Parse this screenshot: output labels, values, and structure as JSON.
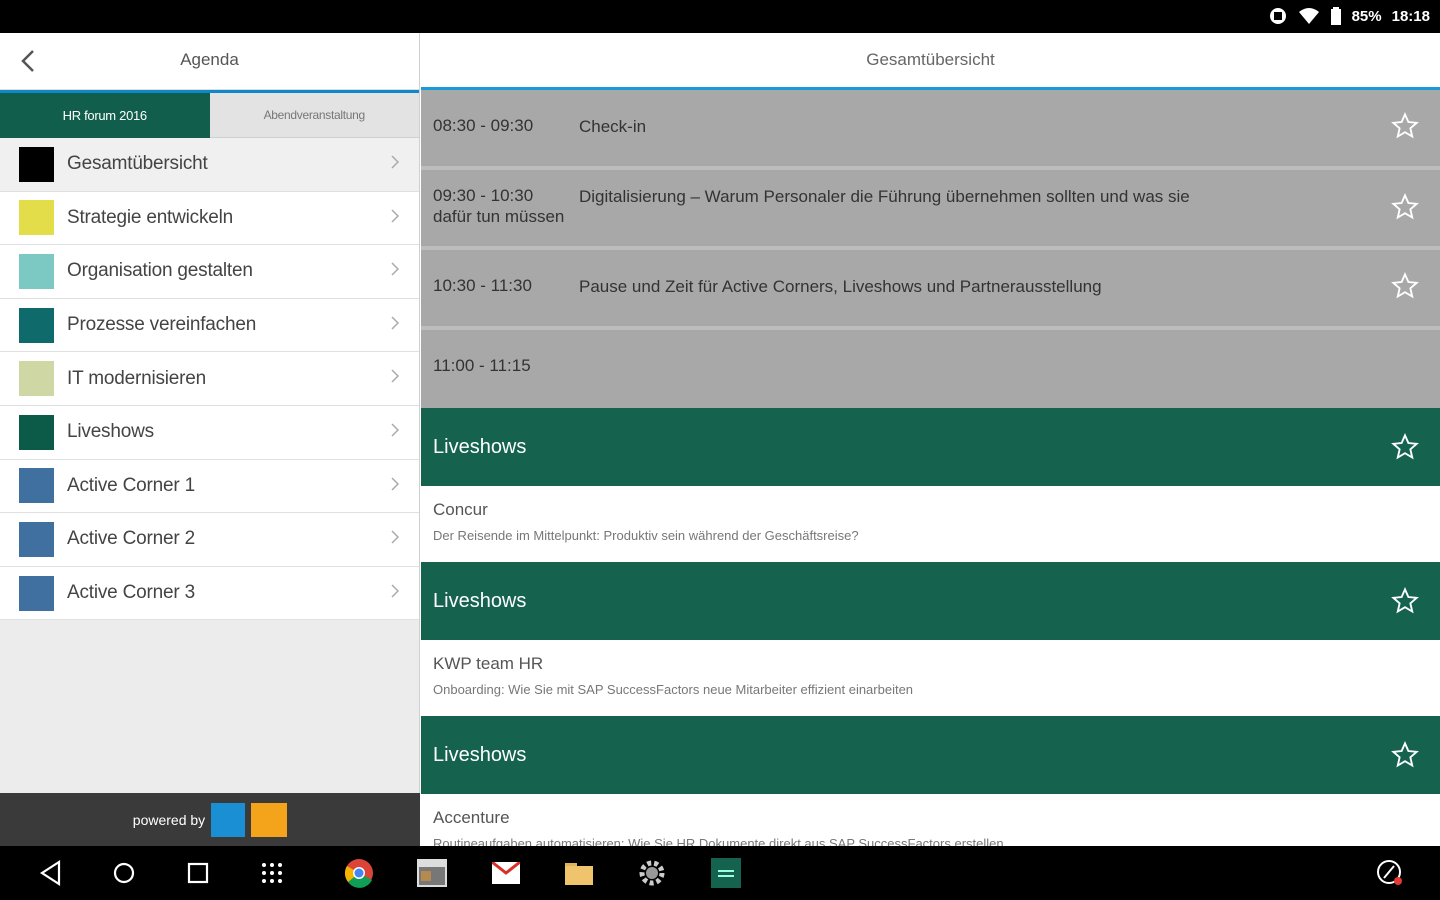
{
  "status": {
    "battery_text": "85%",
    "time": "18:18"
  },
  "left": {
    "title": "Agenda",
    "tabs": [
      {
        "label": "HR forum 2016"
      },
      {
        "label": "Abendveranstaltung"
      }
    ],
    "categories": [
      {
        "label": "Gesamtübersicht",
        "color": "#000000"
      },
      {
        "label": "Strategie entwickeln",
        "color": "#e3dd4a"
      },
      {
        "label": "Organisation gestalten",
        "color": "#7cc9c4"
      },
      {
        "label": "Prozesse vereinfachen",
        "color": "#0f6b6b"
      },
      {
        "label": "IT modernisieren",
        "color": "#cfd7a4"
      },
      {
        "label": "Liveshows",
        "color": "#0c5b48"
      },
      {
        "label": "Active Corner 1",
        "color": "#3f70a0"
      },
      {
        "label": "Active Corner 2",
        "color": "#3f70a0"
      },
      {
        "label": "Active Corner 3",
        "color": "#3f70a0"
      }
    ],
    "powered_by": "powered by"
  },
  "right": {
    "title": "Gesamtübersicht",
    "sessions": [
      {
        "time": "08:30 - 09:30",
        "title": "Check-in"
      },
      {
        "time": "09:30 - 10:30",
        "title": "Digitalisierung – Warum Personaler die Führung übernehmen sollten und was sie",
        "time_cont": "dafür tun müssen"
      },
      {
        "time": "10:30 - 11:30",
        "title": "Pause und Zeit für Active Corners, Liveshows und Partnerausstellung"
      },
      {
        "time": "11:00 - 11:15",
        "title": ""
      }
    ],
    "liveshows": [
      {
        "header": "Liveshows",
        "name": "Concur",
        "desc": "Der Reisende im Mittelpunkt: Produktiv sein während der Geschäftsreise?"
      },
      {
        "header": "Liveshows",
        "name": "KWP team HR",
        "desc": "Onboarding: Wie Sie mit SAP SuccessFactors neue Mitarbeiter effizient einarbeiten"
      },
      {
        "header": "Liveshows",
        "name": "Accenture",
        "desc": "Routineaufgaben automatisieren: Wie Sie HR Dokumente direkt aus SAP SuccessFactors erstellen"
      }
    ]
  },
  "colors": {
    "accent_blue": "#1a9ad6",
    "primary_green": "#15634f",
    "session_gray": "#a8a8a8"
  }
}
